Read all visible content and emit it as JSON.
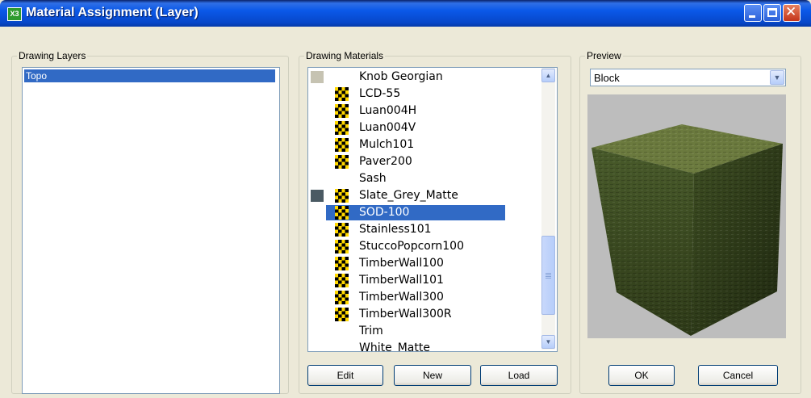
{
  "window": {
    "title": "Material Assignment (Layer)",
    "icon": "x-app-icon",
    "icon_text": "X3"
  },
  "layers": {
    "label": "Drawing Layers",
    "items": [
      "Topo"
    ],
    "selected": "Topo"
  },
  "materials": {
    "label": "Drawing Materials",
    "items": [
      {
        "name": "Knob Georgian",
        "swatch": "#c6c3b2",
        "checker": false
      },
      {
        "name": "LCD-55",
        "swatch": null,
        "checker": true
      },
      {
        "name": "Luan004H",
        "swatch": null,
        "checker": true
      },
      {
        "name": "Luan004V",
        "swatch": null,
        "checker": true
      },
      {
        "name": "Mulch101",
        "swatch": null,
        "checker": true
      },
      {
        "name": "Paver200",
        "swatch": null,
        "checker": true
      },
      {
        "name": "Sash",
        "swatch": null,
        "checker": false
      },
      {
        "name": "Slate_Grey_Matte",
        "swatch": "#4a5a63",
        "checker": true
      },
      {
        "name": "SOD-100",
        "swatch": null,
        "checker": true,
        "selected": true
      },
      {
        "name": "Stainless101",
        "swatch": null,
        "checker": true
      },
      {
        "name": "StuccoPopcorn100",
        "swatch": null,
        "checker": true
      },
      {
        "name": "TimberWall100",
        "swatch": null,
        "checker": true
      },
      {
        "name": "TimberWall101",
        "swatch": null,
        "checker": true
      },
      {
        "name": "TimberWall300",
        "swatch": null,
        "checker": true
      },
      {
        "name": "TimberWall300R",
        "swatch": null,
        "checker": true
      },
      {
        "name": "Trim",
        "swatch": null,
        "checker": false
      },
      {
        "name": "White_Matte",
        "swatch": null,
        "checker": false
      }
    ],
    "buttons": {
      "edit": "Edit",
      "new": "New",
      "load": "Load"
    }
  },
  "preview": {
    "label": "Preview",
    "shape_selected": "Block",
    "colors": {
      "top": "#6b7a3e",
      "left": "#3c4a22",
      "right": "#2c3818",
      "background": "#bdbdbd"
    }
  },
  "dialog_buttons": {
    "ok": "OK",
    "cancel": "Cancel"
  },
  "colors": {
    "selection": "#316ac5",
    "title_bar": "#0a58e8",
    "dialog_bg": "#ece9d8"
  }
}
